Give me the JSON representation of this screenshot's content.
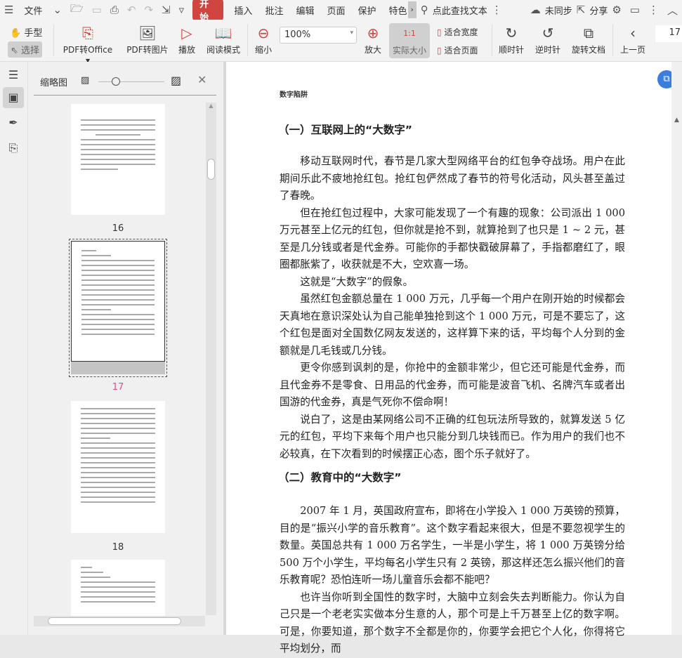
{
  "menubar": {
    "file": "文件",
    "tabs": [
      "开始",
      "插入",
      "批注",
      "编辑",
      "页面",
      "保护",
      "特色"
    ],
    "search_placeholder": "点此查找文本",
    "sync": "未同步",
    "share": "分享"
  },
  "toolbar": {
    "hand": "手型",
    "select": "选择",
    "pdf_to_office": "PDF转Office",
    "pdf_to_image": "PDF转图片",
    "play": "播放",
    "read_mode": "阅读模式",
    "zoom_out": "缩小",
    "zoom_value": "100%",
    "zoom_in": "放大",
    "actual_size": "实际大小",
    "actual_icon": "1:1",
    "fit_width": "适合宽度",
    "fit_page": "适合页面",
    "clockwise": "顺时针",
    "counterclockwise": "逆时针",
    "rotate_doc": "旋转文档",
    "prev_page": "上一页",
    "page_number": "17"
  },
  "panel": {
    "title": "缩略图",
    "pages": [
      "16",
      "17",
      "18"
    ]
  },
  "document": {
    "running_header": "数字陷阱",
    "heading1": "（一）互联网上的“大数字”",
    "section1": [
      "移动互联网时代，春节是几家大型网络平台的红包争夺战场。用户在此期间乐此不疲地抢红包。抢红包俨然成了春节的符号化活动，风头甚至盖过了春晚。",
      "但在抢红包过程中，大家可能发现了一个有趣的现象：公司派出 1 000 万元甚至上亿元的红包，但你就是抢不到，就算抢到了也只是 1 ~ 2 元，甚至是几分钱或者是代金券。可能你的手都快戳破屏幕了，手指都磨红了，眼圈都胀紫了，收获就是不大，空欢喜一场。",
      "这就是“大数字”的假象。",
      "虽然红包金额总量在 1 000 万元，几乎每一个用户在刚开始的时候都会天真地在意识深处认为自己能单独抢到这个 1 000 万元，可是不要忘了，这个红包是面对全国数亿网友发送的，这样算下来的话，平均每个人分到的金额就是几毛钱或几分钱。",
      "更令你感到讽刺的是，你抢中的金额非常少，但它还可能是代金券，而且代金券不是零食、日用品的代金券，而可能是波音飞机、名牌汽车或者出国游的代金券，真是气死你不偿命啊！",
      "说白了，这是由某网络公司不正确的红包玩法所导致的，就算发送 5 亿元的红包，平均下来每个用户也只能分到几块钱而已。作为用户的我们也不必较真，在下次看到的时候摆正心态，图个乐子就好了。"
    ],
    "heading2": "（二）教育中的“大数字”",
    "section2": [
      "2007 年 1 月，英国政府宣布，即将在小学投入 1 000 万英镑的预算，目的是“振兴小学的音乐教育”。这个数字看起来很大，但是不要忽视学生的数量。英国总共有 1 000 万名学生，一半是小学生，将 1 000 万英镑分给 500 万个小学生，平均每名小学生只有 2 英镑，那这样还怎么振兴他们的音乐教育呢？恐怕连听一场儿童音乐会都不能吧？",
      "也许当你听到全国性的数字时，大脑中立刻会失去判断能力。你认为自己只是一个老老实实做本分生意的人，那个可是上千万甚至上亿的数字啊。可是，你要知道，那个数字不全都是你的，你要学会把它个人化，你得将它平均划分，而"
    ]
  },
  "colors": {
    "accent": "#d0453f",
    "selected_page": "#e0508a"
  }
}
